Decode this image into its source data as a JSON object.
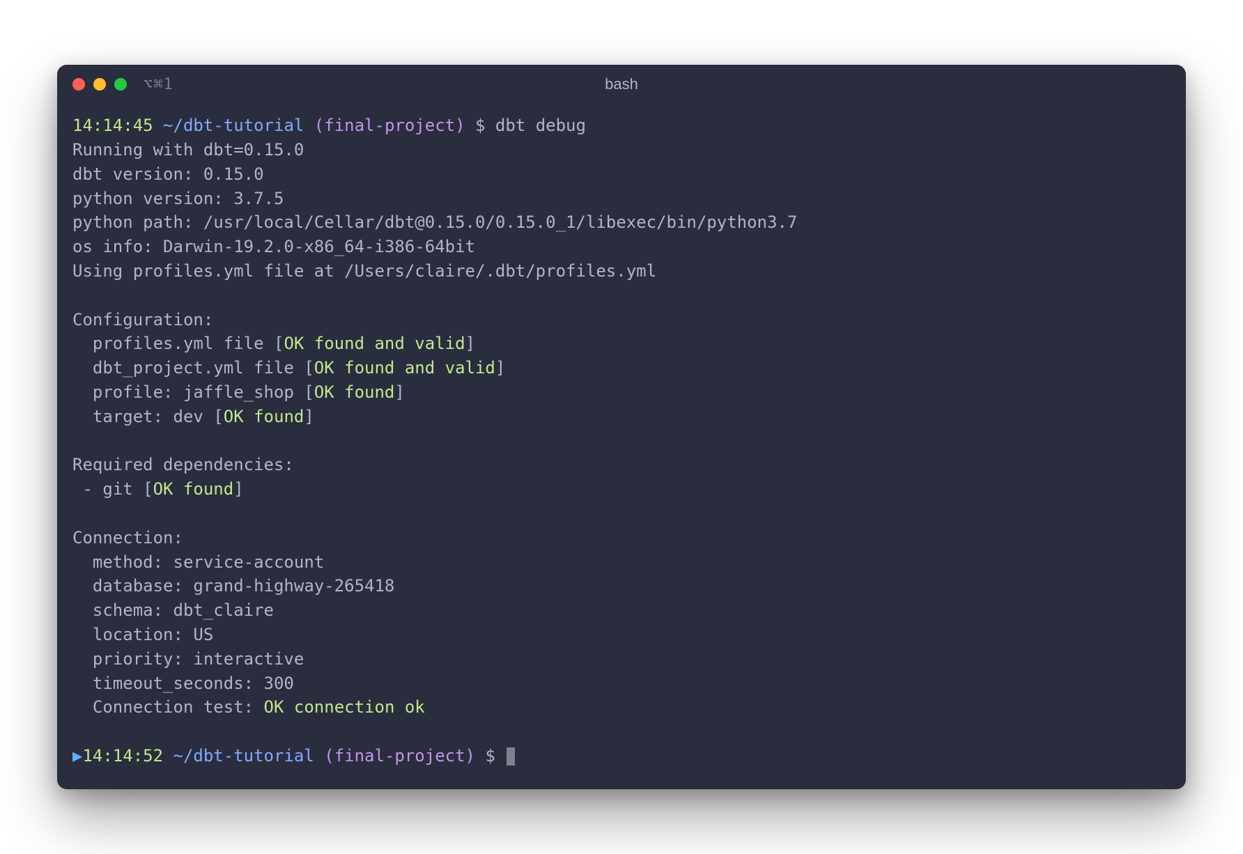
{
  "window": {
    "tab_indicator": "⌥⌘1",
    "title": "bash"
  },
  "prompt1": {
    "time": "14:14:45",
    "path": "~/dbt-tutorial",
    "branch": "(final-project)",
    "symbol": "$",
    "command": "dbt debug"
  },
  "output": {
    "running": "Running with dbt=0.15.0",
    "dbt_version": "dbt version: 0.15.0",
    "python_version": "python version: 3.7.5",
    "python_path": "python path: /usr/local/Cellar/dbt@0.15.0/0.15.0_1/libexec/bin/python3.7",
    "os_info": "os info: Darwin-19.2.0-x86_64-i386-64bit",
    "profiles_file": "Using profiles.yml file at /Users/claire/.dbt/profiles.yml",
    "config_header": "Configuration:",
    "config_profiles_pre": "  profiles.yml file [",
    "config_profiles_ok": "OK found and valid",
    "config_dbtproj_pre": "  dbt_project.yml file [",
    "config_dbtproj_ok": "OK found and valid",
    "config_profile_pre": "  profile: jaffle_shop [",
    "config_profile_ok": "OK found",
    "config_target_pre": "  target: dev [",
    "config_target_ok": "OK found",
    "bracket_close": "]",
    "deps_header": "Required dependencies:",
    "deps_git_pre": " - git [",
    "deps_git_ok": "OK found",
    "conn_header": "Connection:",
    "conn_method": "  method: service-account",
    "conn_database": "  database: grand-highway-265418",
    "conn_schema": "  schema: dbt_claire",
    "conn_location": "  location: US",
    "conn_priority": "  priority: interactive",
    "conn_timeout": "  timeout_seconds: 300",
    "conn_test_pre": "  Connection test: ",
    "conn_test_ok": "OK connection ok"
  },
  "prompt2": {
    "arrow": "▶",
    "time": "14:14:52",
    "path": "~/dbt-tutorial",
    "branch": "(final-project)",
    "symbol": "$"
  }
}
